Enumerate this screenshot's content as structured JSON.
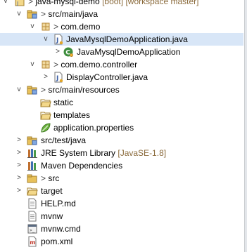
{
  "project": {
    "name": "java-mysql-demo",
    "boot_tag": "[boot]",
    "workspace_tag": "[workspace master]"
  },
  "tree": {
    "src_main_java": "src/main/java",
    "pkg_com_demo": "com.demo",
    "app_file": "JavaMysqlDemoApplication.java",
    "app_class": "JavaMysqlDemoApplication",
    "pkg_controller": "com.demo.controller",
    "controller_file": "DisplayController.java",
    "src_main_resources": "src/main/resources",
    "static": "static",
    "templates": "templates",
    "application_properties": "application.properties",
    "src_test_java": "src/test/java",
    "jre_library": "JRE System Library",
    "jre_version": "[JavaSE-1.8]",
    "maven_deps": "Maven Dependencies",
    "src": "src",
    "target": "target",
    "help": "HELP.md",
    "mvnw": "mvnw",
    "mvnw_cmd": "mvnw.cmd",
    "pom": "pom.xml"
  },
  "glyphs": {
    "expanded": "v",
    "collapsed": ">",
    "dirty": ">"
  },
  "colors": {
    "selection": "#d8e6f7",
    "folder": "#e8c15a",
    "decoration_text": "#8a6a3b",
    "package": "#b88a3a",
    "class_green": "#3e8e3e"
  }
}
